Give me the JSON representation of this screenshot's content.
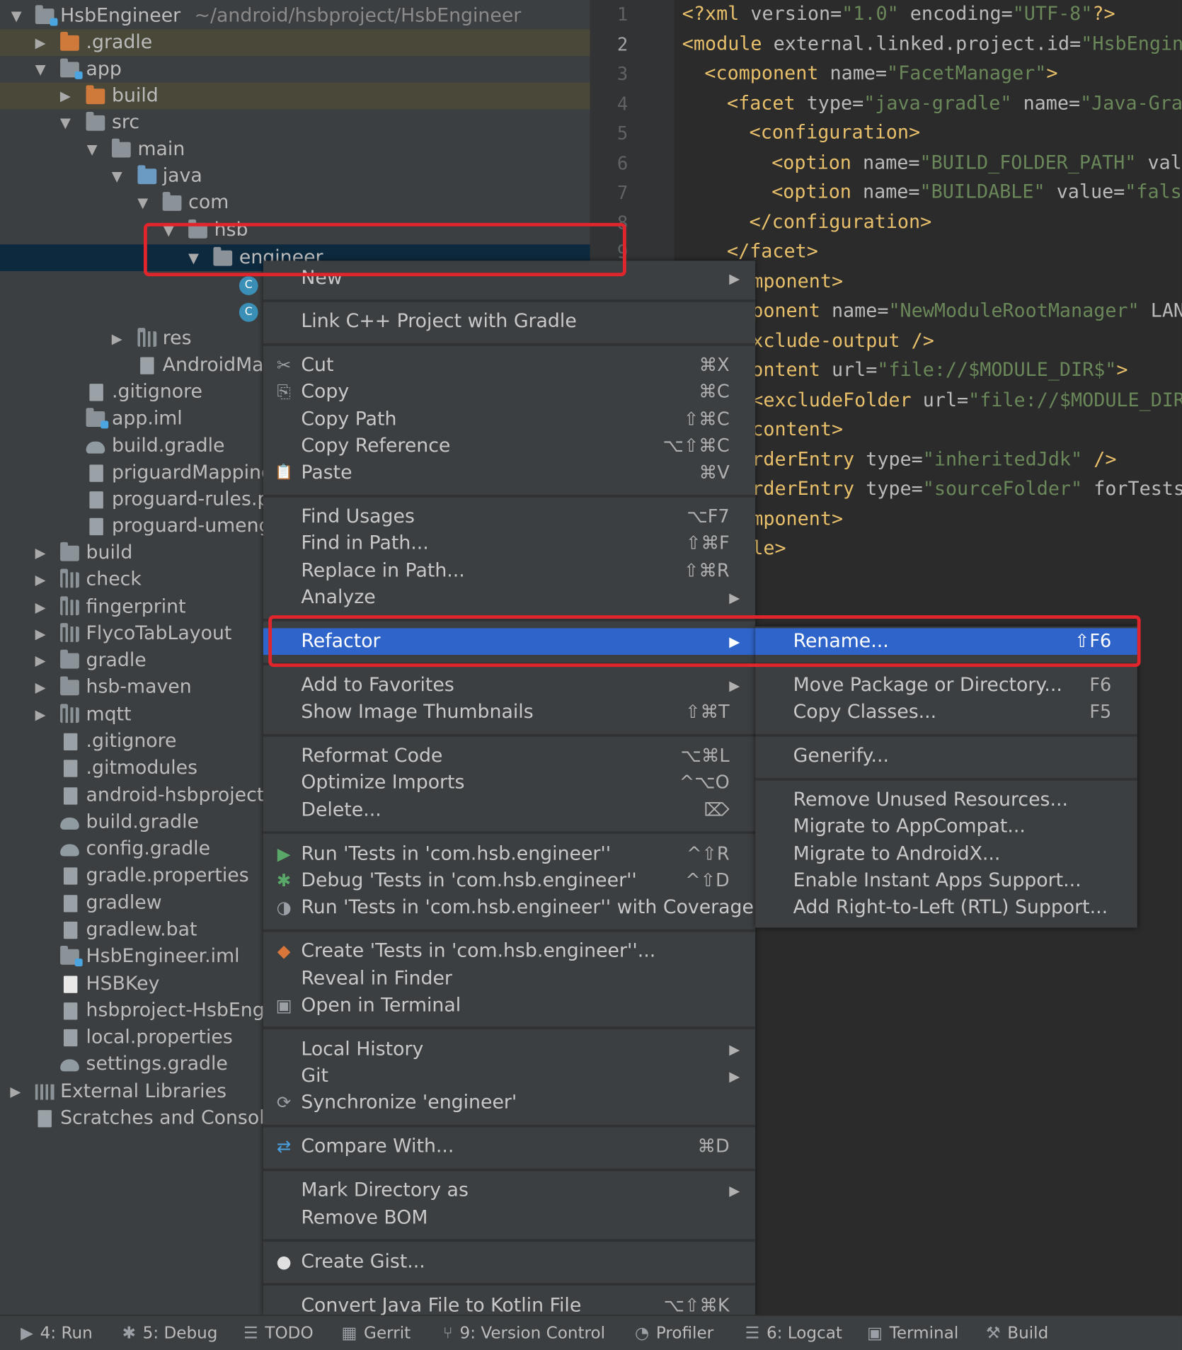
{
  "project_tree": {
    "root": {
      "label": "HsbEngineer",
      "path": "~/android/hsbproject/HsbEngineer"
    },
    "items": [
      ".gradle",
      "app",
      "build",
      "src",
      "main",
      "java",
      "com",
      "hsb",
      "engineer",
      "res",
      "AndroidMan",
      ".gitignore",
      "app.iml",
      "build.gradle",
      "priguardMapping",
      "proguard-rules.p",
      "proguard-umeng",
      "build",
      "check",
      "fingerprint",
      "FlycoTabLayout",
      "gradle",
      "hsb-maven",
      "mqtt",
      ".gitignore",
      ".gitmodules",
      "android-hsbproject-",
      "build.gradle",
      "config.gradle",
      "gradle.properties",
      "gradlew",
      "gradlew.bat",
      "HsbEngineer.iml",
      "HSBKey",
      "hsbproject-HsbEngi",
      "local.properties",
      "settings.gradle",
      "External Libraries",
      "Scratches and Console"
    ],
    "class_badge": "C"
  },
  "editor": {
    "line_numbers": [
      "1",
      "2",
      "3",
      "4",
      "5",
      "6",
      "7",
      "8",
      "9"
    ],
    "lines": [
      [
        "<?xml ",
        "version=",
        "\"1.0\"",
        " encoding=",
        "\"UTF-8\"",
        "?>"
      ],
      [
        "<module ",
        "external.linked.project.id=",
        "\"HsbEngin"
      ],
      [
        "<component ",
        "name=",
        "\"FacetManager\"",
        ">"
      ],
      [
        "<facet ",
        "type=",
        "\"java-gradle\"",
        " name=",
        "\"Java-Gra"
      ],
      [
        "<configuration>"
      ],
      [
        "<option ",
        "name=",
        "\"BUILD_FOLDER_PATH\"",
        " val"
      ],
      [
        "<option ",
        "name=",
        "\"BUILDABLE\"",
        " value=",
        "\"fals"
      ],
      [
        "</configuration>"
      ],
      [
        "</facet>"
      ],
      [
        "mponent>"
      ],
      [
        "ponent ",
        "name=",
        "\"NewModuleRootManager\"",
        " LAN"
      ],
      [
        "xclude-output />"
      ],
      [
        "ontent ",
        "url=",
        "\"file://$MODULE_DIR$\"",
        ">"
      ],
      [
        "<excludeFolder ",
        "url=",
        "\"file://$MODULE_DIR"
      ],
      [
        "content>"
      ],
      [
        "rderEntry ",
        "type=",
        "\"inheritedJdk\"",
        " />"
      ],
      [
        "rderEntry ",
        "type=",
        "\"sourceFolder\"",
        " forTests"
      ],
      [
        "mponent>"
      ],
      [
        "le>"
      ]
    ]
  },
  "context_menu": {
    "items": [
      {
        "label": "New",
        "shortcut": "",
        "arrow": true
      },
      {
        "label": "Link C++ Project with Gradle",
        "shortcut": ""
      },
      {
        "label": "Cut",
        "shortcut": "⌘X",
        "icon": "✂"
      },
      {
        "label": "Copy",
        "shortcut": "⌘C",
        "icon": "⎘"
      },
      {
        "label": "Copy Path",
        "shortcut": "⇧⌘C"
      },
      {
        "label": "Copy Reference",
        "shortcut": "⌥⇧⌘C"
      },
      {
        "label": "Paste",
        "shortcut": "⌘V",
        "icon": "📋"
      },
      {
        "label": "Find Usages",
        "shortcut": "⌥F7"
      },
      {
        "label": "Find in Path...",
        "shortcut": "⇧⌘F"
      },
      {
        "label": "Replace in Path...",
        "shortcut": "⇧⌘R"
      },
      {
        "label": "Analyze",
        "shortcut": "",
        "arrow": true
      },
      {
        "label": "Refactor",
        "shortcut": "",
        "arrow": true
      },
      {
        "label": "Add to Favorites",
        "shortcut": "",
        "arrow": true
      },
      {
        "label": "Show Image Thumbnails",
        "shortcut": "⇧⌘T"
      },
      {
        "label": "Reformat Code",
        "shortcut": "⌥⌘L"
      },
      {
        "label": "Optimize Imports",
        "shortcut": "^⌥O"
      },
      {
        "label": "Delete...",
        "shortcut": "⌦"
      },
      {
        "label": "Run 'Tests in 'com.hsb.engineer''",
        "shortcut": "^⇧R",
        "icon": "▶"
      },
      {
        "label": "Debug 'Tests in 'com.hsb.engineer''",
        "shortcut": "^⇧D",
        "icon": "✱"
      },
      {
        "label": "Run 'Tests in 'com.hsb.engineer'' with Coverage",
        "shortcut": "",
        "icon": "◑"
      },
      {
        "label": "Create 'Tests in 'com.hsb.engineer''...",
        "shortcut": "",
        "icon": "◆"
      },
      {
        "label": "Reveal in Finder",
        "shortcut": ""
      },
      {
        "label": "Open in Terminal",
        "shortcut": "",
        "icon": "▣"
      },
      {
        "label": "Local History",
        "shortcut": "",
        "arrow": true
      },
      {
        "label": "Git",
        "shortcut": "",
        "arrow": true
      },
      {
        "label": "Synchronize 'engineer'",
        "shortcut": "",
        "icon": "⟳"
      },
      {
        "label": "Compare With...",
        "shortcut": "⌘D",
        "icon": "⇄"
      },
      {
        "label": "Mark Directory as",
        "shortcut": "",
        "arrow": true
      },
      {
        "label": "Remove BOM",
        "shortcut": ""
      },
      {
        "label": "Create Gist...",
        "shortcut": "",
        "icon": "●"
      },
      {
        "label": "Convert Java File to Kotlin File",
        "shortcut": "⌥⇧⌘K"
      }
    ]
  },
  "refactor_submenu": {
    "items": [
      {
        "label": "Rename...",
        "shortcut": "⇧F6"
      },
      {
        "label": "Move Package or Directory...",
        "shortcut": "F6"
      },
      {
        "label": "Copy Classes...",
        "shortcut": "F5"
      },
      {
        "label": "Generify...",
        "shortcut": ""
      },
      {
        "label": "Remove Unused Resources...",
        "shortcut": ""
      },
      {
        "label": "Migrate to AppCompat...",
        "shortcut": ""
      },
      {
        "label": "Migrate to AndroidX...",
        "shortcut": ""
      },
      {
        "label": "Enable Instant Apps Support...",
        "shortcut": ""
      },
      {
        "label": "Add Right-to-Left (RTL) Support...",
        "shortcut": ""
      }
    ]
  },
  "status_bar": {
    "items": [
      {
        "label": "4: Run",
        "icon": "▶"
      },
      {
        "label": "5: Debug",
        "icon": "✱"
      },
      {
        "label": "TODO",
        "icon": "☰"
      },
      {
        "label": "Gerrit",
        "icon": "▦"
      },
      {
        "label": "9: Version Control",
        "icon": "⑂"
      },
      {
        "label": "Profiler",
        "icon": "◔"
      },
      {
        "label": "6: Logcat",
        "icon": "☰"
      },
      {
        "label": "Terminal",
        "icon": "▣"
      },
      {
        "label": "Build",
        "icon": "⚒"
      }
    ]
  },
  "colors": {
    "highlight": "#2f65ca",
    "annotation_box": "#e0252d",
    "selected_row": "#0d293e"
  }
}
